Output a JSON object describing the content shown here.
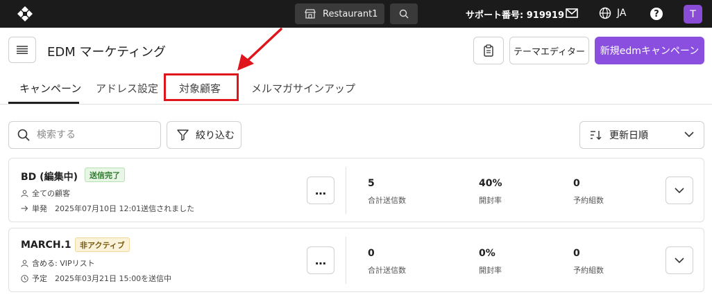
{
  "topbar": {
    "store_name": "Restaurant1",
    "support_label": "サポート番号: 919919",
    "language": "JA",
    "help_glyph": "?",
    "avatar_initial": "T",
    "icons": [
      "logo-icon",
      "store-icon",
      "search-icon",
      "mail-icon",
      "globe-icon",
      "help-icon"
    ]
  },
  "header": {
    "title": "EDM マーケティング",
    "theme_editor_label": "テーマエディター",
    "new_campaign_label": "新規edmキャンペーン"
  },
  "tabs": [
    {
      "label": "キャンペーン",
      "active": true
    },
    {
      "label": "アドレス設定",
      "active": false
    },
    {
      "label": "対象顧客",
      "active": false,
      "highlighted": true
    },
    {
      "label": "メルマガサインアップ",
      "active": false
    }
  ],
  "filters": {
    "search_placeholder": "検索する",
    "filter_label": "絞り込む",
    "sort_label": "更新日順"
  },
  "campaigns": [
    {
      "name": "BD (編集中)",
      "status": "送信完了",
      "audience": "全ての顧客",
      "schedule": "単発　2025年07月10日 12:01送信されました",
      "more": "…",
      "stats": [
        {
          "value": "5",
          "label": "合計送信数"
        },
        {
          "value": "40%",
          "label": "開封率"
        },
        {
          "value": "0",
          "label": "予約組数"
        }
      ]
    },
    {
      "name": "MARCH.1",
      "status": "非アクティブ",
      "audience": "含める: VIPリスト",
      "schedule": "予定　2025年03月21日 15:00を送信中",
      "more": "…",
      "stats": [
        {
          "value": "0",
          "label": "合計送信数"
        },
        {
          "value": "0%",
          "label": "開封率"
        },
        {
          "value": "0",
          "label": "予約組数"
        }
      ]
    }
  ],
  "colors": {
    "topbar": "#1b1b1b",
    "primary": "#8b4fe0",
    "annotation": "#e0141b",
    "avatar": "#8a4bd6"
  }
}
